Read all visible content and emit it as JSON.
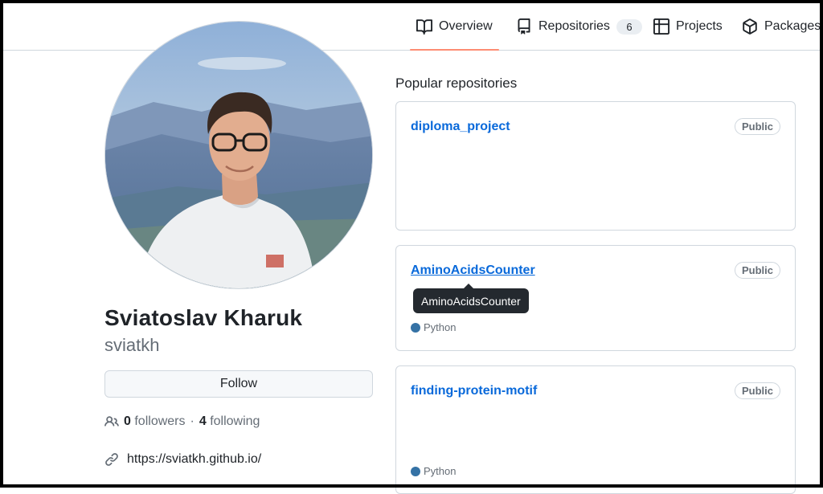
{
  "nav": {
    "tabs": [
      {
        "label": "Overview",
        "icon": "book-icon",
        "active": true
      },
      {
        "label": "Repositories",
        "icon": "repo-icon",
        "count": "6"
      },
      {
        "label": "Projects",
        "icon": "table-icon"
      },
      {
        "label": "Packages",
        "icon": "package-icon"
      }
    ]
  },
  "profile": {
    "name": "Sviatoslav Kharuk",
    "login": "sviatkh",
    "follow_label": "Follow",
    "followers_count": "0",
    "followers_label": "followers",
    "separator": "·",
    "following_count": "4",
    "following_label": "following",
    "website": "https://sviatkh.github.io/"
  },
  "popular": {
    "title": "Popular repositories",
    "repos": [
      {
        "name": "diploma_project",
        "visibility": "Public"
      },
      {
        "name": "AminoAcidsCounter",
        "visibility": "Public",
        "language": "Python"
      },
      {
        "name": "finding-protein-motif",
        "visibility": "Public",
        "language": "Python"
      }
    ],
    "tooltip": "AminoAcidsCounter"
  },
  "colors": {
    "link": "#0969da",
    "python": "#3572A5",
    "tab_underline": "#fd8c73"
  }
}
